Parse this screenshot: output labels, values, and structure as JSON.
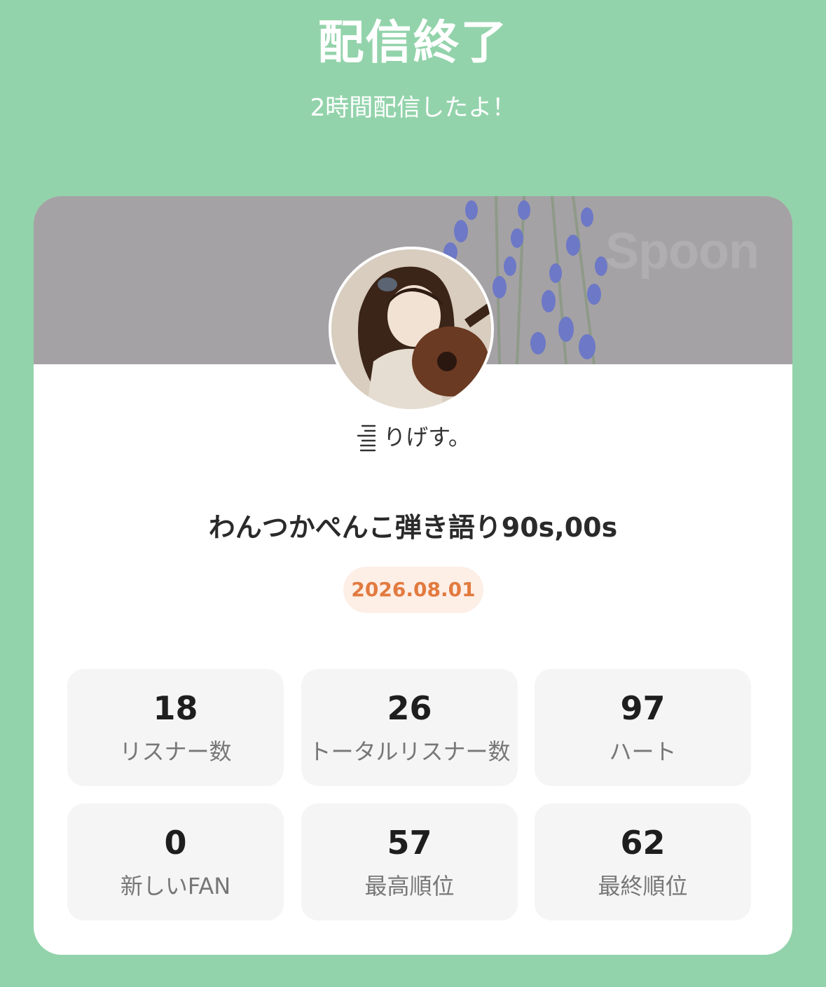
{
  "header": {
    "title": "配信終了",
    "subtitle": "2時間配信したよ！"
  },
  "card": {
    "banner_watermark": "Spoon",
    "username": "りげす。",
    "broadcast_title": "わんつかぺんこ弾き語り90s,00s",
    "date": "2026.08.01",
    "stats": [
      {
        "value": "18",
        "label": "リスナー数"
      },
      {
        "value": "26",
        "label": "トータルリスナー数"
      },
      {
        "value": "97",
        "label": "ハート"
      },
      {
        "value": "0",
        "label": "新しいFAN"
      },
      {
        "value": "57",
        "label": "最高順位"
      },
      {
        "value": "62",
        "label": "最終順位"
      }
    ]
  },
  "colors": {
    "background": "#93d3ab",
    "card": "#ffffff",
    "date_text": "#e27a3f",
    "date_badge": "#fdeee6",
    "stat_box": "#f5f5f5"
  },
  "icons": {
    "user_badge": "lines-badge-icon"
  }
}
